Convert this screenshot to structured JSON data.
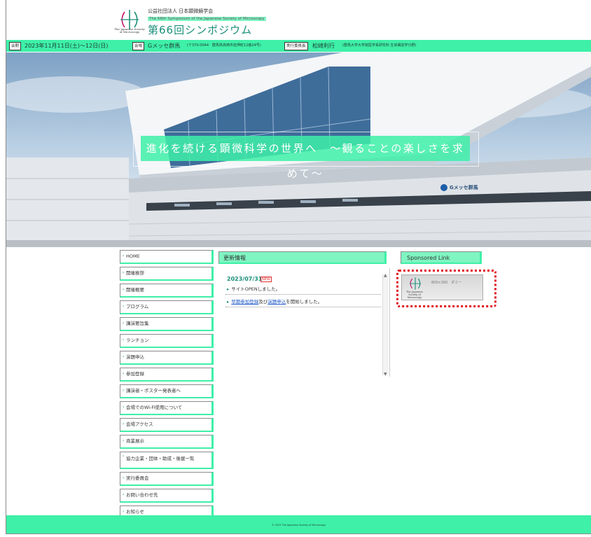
{
  "header": {
    "org_name": "公益社団法人 日本顕微鏡学会",
    "org_en": "The 66th Symposium of the Japanese Society of Microscopy",
    "symposium_title": "第66回シンポジウム",
    "logo_caption": "The Japanese Society of Microscopy"
  },
  "info": {
    "date_tag": "会期",
    "date": "2023年11月11日(土)～12日(日)",
    "venue_tag": "会場",
    "venue": "Gメッセ群馬",
    "venue_address": "(〒370-0044　群馬県高崎市岩押町12番24号)",
    "chair_tag": "実行委員長",
    "chair": "松崎利行",
    "chair_affil": "(群馬大学大学院医学系研究科 生体構造学分野)"
  },
  "hero": {
    "catchphrase": "進化を続ける顕微科学の世界へ　～観ることの楽しさを求めて～",
    "building_sign": "Gメッセ群馬"
  },
  "nav": {
    "items": [
      {
        "label": "HOME"
      },
      {
        "label": "開催挨拶"
      },
      {
        "label": "開催概要"
      },
      {
        "label": "プログラム"
      },
      {
        "label": "講演要旨集"
      },
      {
        "label": "ランチョン"
      },
      {
        "label": "演題申込"
      },
      {
        "label": "参加登録"
      },
      {
        "label": "講演者・ポスター発表者へ"
      },
      {
        "label": "会場でのWi-Fi使用について"
      },
      {
        "label": "会場アクセス"
      },
      {
        "label": "商業展示"
      },
      {
        "label": "協力企業・団体・助成・後援一覧"
      },
      {
        "label": "実行委員会"
      },
      {
        "label": "お問い合わせ先"
      },
      {
        "label": "お知らせ"
      }
    ]
  },
  "news": {
    "heading": "更新情報",
    "date": "2023/07/31",
    "badge": "NEW",
    "line1": "サイトOPENしました。",
    "line2_link1": "早期参加登録",
    "line2_mid": "及び",
    "line2_link2": "演題申込",
    "line2_end": "を開始しました。"
  },
  "sponsor": {
    "heading": "Sponsored Link",
    "banner_text": "800×300　ダミー",
    "banner_caption": "The Japanese Society of Microscopy"
  },
  "footer": {
    "copyright": "© 2023 The Japanese Society of Microscopy"
  },
  "colors": {
    "accent": "#3ef0a8",
    "accent_light": "#7ff5c2",
    "title_green": "#1a8f7a",
    "highlight_red": "#e0141e",
    "link_blue": "#1a57c8"
  }
}
